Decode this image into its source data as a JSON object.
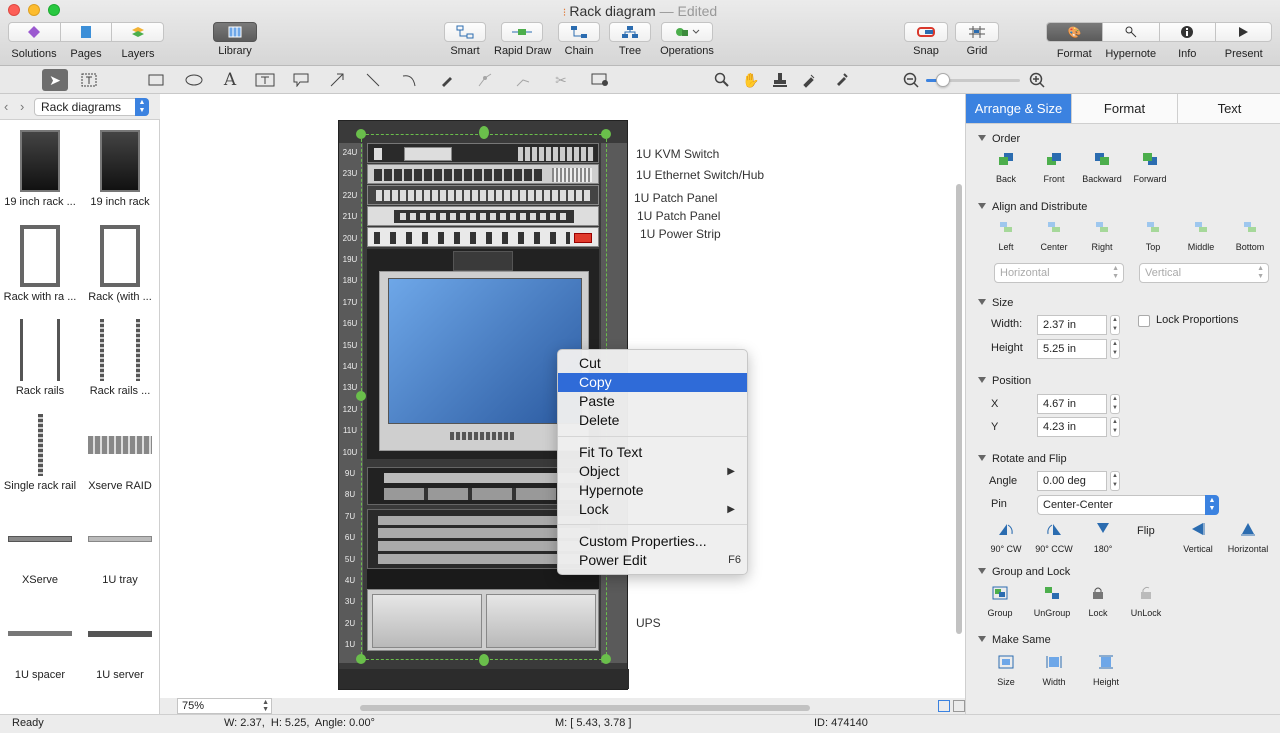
{
  "window": {
    "title": "Rack diagram",
    "edited": "— Edited"
  },
  "toolbar": {
    "left": [
      {
        "label": "Solutions",
        "icon": "solutions-icon"
      },
      {
        "label": "Pages",
        "icon": "pages-icon"
      },
      {
        "label": "Layers",
        "icon": "layers-icon"
      }
    ],
    "library": {
      "label": "Library",
      "icon": "library-icon"
    },
    "center": [
      {
        "label": "Smart"
      },
      {
        "label": "Rapid Draw"
      },
      {
        "label": "Chain"
      },
      {
        "label": "Tree"
      },
      {
        "label": "Operations"
      }
    ],
    "snapgrid": [
      {
        "label": "Snap"
      },
      {
        "label": "Grid"
      }
    ],
    "right": [
      {
        "label": "Format"
      },
      {
        "label": "Hypernote"
      },
      {
        "label": "Info"
      },
      {
        "label": "Present"
      }
    ]
  },
  "library": {
    "selector": "Rack diagrams",
    "items": [
      {
        "caption": "19 inch rack ..."
      },
      {
        "caption": "19 inch rack"
      },
      {
        "caption": "Rack with ra ..."
      },
      {
        "caption": "Rack (with ..."
      },
      {
        "caption": "Rack rails"
      },
      {
        "caption": "Rack rails ..."
      },
      {
        "caption": "Single rack rail"
      },
      {
        "caption": "Xserve RAID"
      },
      {
        "caption": "XServe"
      },
      {
        "caption": "1U tray"
      },
      {
        "caption": "1U spacer"
      },
      {
        "caption": "1U server"
      }
    ]
  },
  "diagram": {
    "units": [
      "24U",
      "23U",
      "22U",
      "21U",
      "20U",
      "19U",
      "18U",
      "17U",
      "16U",
      "15U",
      "14U",
      "13U",
      "12U",
      "11U",
      "10U",
      "9U",
      "8U",
      "7U",
      "6U",
      "5U",
      "4U",
      "3U",
      "2U",
      "1U"
    ],
    "labels": [
      "1U KVM Switch",
      "1U Ethernet Switch/Hub",
      "1U Patch Panel",
      "1U Patch Panel",
      "1U Power Strip",
      "UPS"
    ]
  },
  "context_menu": {
    "groups": [
      [
        {
          "label": "Cut"
        },
        {
          "label": "Copy",
          "selected": true
        },
        {
          "label": "Paste"
        },
        {
          "label": "Delete"
        }
      ],
      [
        {
          "label": "Fit To Text"
        },
        {
          "label": "Object",
          "submenu": true
        },
        {
          "label": "Hypernote"
        },
        {
          "label": "Lock",
          "submenu": true
        }
      ],
      [
        {
          "label": "Custom Properties..."
        },
        {
          "label": "Power Edit",
          "shortcut": "F6"
        }
      ]
    ]
  },
  "zoom": {
    "value": "75%"
  },
  "panel": {
    "tabs": [
      "Arrange & Size",
      "Format",
      "Text"
    ],
    "order": {
      "title": "Order",
      "buttons": [
        "Back",
        "Front",
        "Backward",
        "Forward"
      ]
    },
    "align": {
      "title": "Align and Distribute",
      "buttons": [
        "Left",
        "Center",
        "Right",
        "Top",
        "Middle",
        "Bottom"
      ],
      "horizontal": "Horizontal",
      "vertical": "Vertical"
    },
    "size": {
      "title": "Size",
      "width_label": "Width:",
      "width": "2.37 in",
      "height_label": "Height",
      "height": "5.25 in",
      "lock": "Lock Proportions"
    },
    "position": {
      "title": "Position",
      "x_label": "X",
      "x": "4.67 in",
      "y_label": "Y",
      "y": "4.23 in"
    },
    "rotate": {
      "title": "Rotate and Flip",
      "angle_label": "Angle",
      "angle": "0.00 deg",
      "pin_label": "Pin",
      "pin": "Center-Center",
      "buttons": [
        "90° CW",
        "90° CCW",
        "180°"
      ],
      "flip": "Flip",
      "flip_buttons": [
        "Vertical",
        "Horizontal"
      ]
    },
    "group": {
      "title": "Group and Lock",
      "buttons": [
        "Group",
        "UnGroup",
        "Lock",
        "UnLock"
      ]
    },
    "same": {
      "title": "Make Same",
      "buttons": [
        "Size",
        "Width",
        "Height"
      ]
    }
  },
  "status": {
    "ready": "Ready",
    "dims": "W: 2.37,  H: 5.25,  Angle: 0.00°",
    "mouse": "M: [ 5.43, 3.78 ]",
    "id": "ID: 474140"
  },
  "colors": {
    "accent": "#2f6bd8",
    "tab_active": "#3b82e0",
    "selection": "#6abf4b",
    "rack": "#3a3a3a"
  }
}
